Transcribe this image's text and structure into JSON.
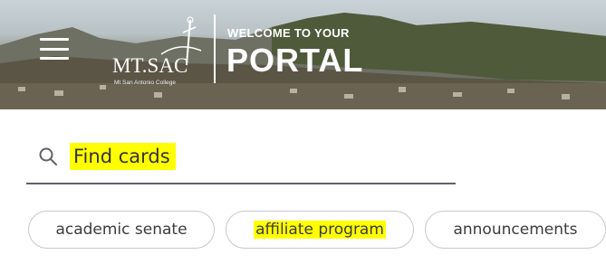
{
  "header": {
    "menu_icon": "hamburger-menu-icon",
    "logo": {
      "name": "MT.SAC",
      "subtitle": "Mt San Antonio College"
    },
    "welcome_text": "WELCOME TO YOUR",
    "title": "PORTAL"
  },
  "search": {
    "icon": "search-icon",
    "placeholder": "Find cards",
    "highlight_color": "#ffff00"
  },
  "chips": [
    {
      "label": "academic senate",
      "highlighted": false
    },
    {
      "label": "affiliate program",
      "highlighted": true
    },
    {
      "label": "announcements",
      "highlighted": false
    }
  ]
}
